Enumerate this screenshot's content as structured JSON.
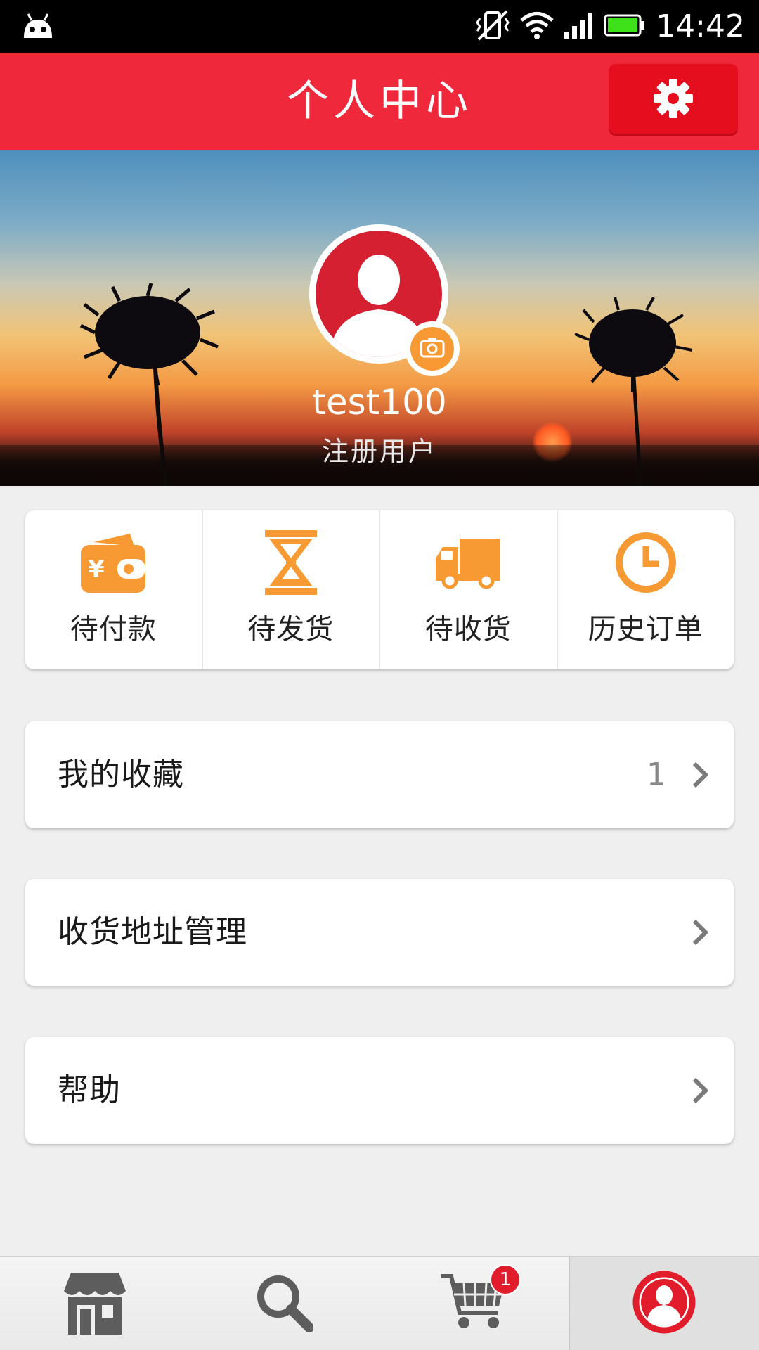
{
  "status_bar": {
    "time": "14:42",
    "icons": [
      "android-icon",
      "vibrate-off-icon",
      "wifi-icon",
      "signal-icon",
      "battery-icon"
    ]
  },
  "header": {
    "title": "个人中心",
    "settings_icon": "gear-icon"
  },
  "profile": {
    "username": "test100",
    "user_type": "注册用户",
    "avatar_icon": "user-silhouette-icon",
    "camera_icon": "camera-icon"
  },
  "orders": [
    {
      "label": "待付款",
      "icon": "wallet-icon"
    },
    {
      "label": "待发货",
      "icon": "hourglass-icon"
    },
    {
      "label": "待收货",
      "icon": "truck-icon"
    },
    {
      "label": "历史订单",
      "icon": "clock-icon"
    }
  ],
  "menu": [
    {
      "label": "我的收藏",
      "count": "1"
    },
    {
      "label": "收货地址管理",
      "count": ""
    },
    {
      "label": "帮助",
      "count": ""
    }
  ],
  "bottom_nav": {
    "items": [
      "store-icon",
      "search-icon",
      "cart-icon",
      "profile-icon"
    ],
    "cart_badge": "1",
    "active": "profile-icon"
  },
  "colors": {
    "brand_red": "#f0283c",
    "button_red": "#e40e1e",
    "accent_orange": "#f79a33",
    "avatar_red": "#d52032"
  }
}
